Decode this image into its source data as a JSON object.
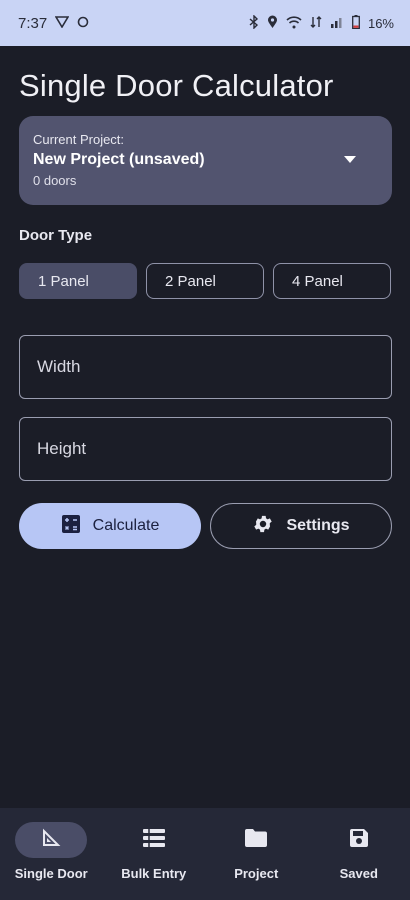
{
  "status_bar": {
    "time": "7:37",
    "battery": "16%"
  },
  "page": {
    "title": "Single Door Calculator"
  },
  "project": {
    "label": "Current Project:",
    "name": "New Project (unsaved)",
    "count": "0 doors"
  },
  "door_type": {
    "label": "Door Type",
    "options": [
      {
        "label": "1 Panel",
        "selected": true
      },
      {
        "label": "2 Panel",
        "selected": false
      },
      {
        "label": "4 Panel",
        "selected": false
      }
    ]
  },
  "fields": {
    "width_placeholder": "Width",
    "height_placeholder": "Height"
  },
  "actions": {
    "calculate": "Calculate",
    "settings": "Settings"
  },
  "nav": {
    "items": [
      {
        "label": "Single Door",
        "icon": "set-square-icon",
        "active": true
      },
      {
        "label": "Bulk Entry",
        "icon": "list-icon",
        "active": false
      },
      {
        "label": "Project",
        "icon": "folder-icon",
        "active": false
      },
      {
        "label": "Saved",
        "icon": "save-icon",
        "active": false
      }
    ]
  },
  "colors": {
    "background": "#1b1d27",
    "status_bar": "#c9d4f5",
    "card": "#52546f",
    "accent_button": "#b7c6f5",
    "nav_background": "#252837"
  }
}
